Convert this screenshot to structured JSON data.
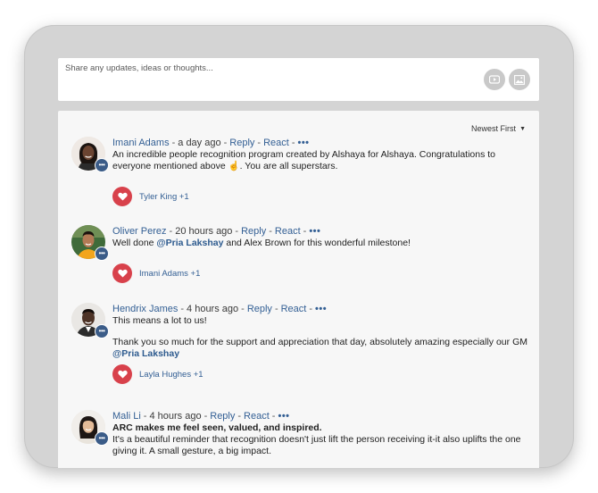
{
  "composer": {
    "placeholder": "Share any updates, ideas or thoughts..."
  },
  "feed": {
    "sort_label": "Newest First",
    "separator": "-",
    "reply_label": "Reply",
    "react_label": "React",
    "more_label": "•••",
    "comments": [
      {
        "author": "Imani Adams",
        "time": "a day ago",
        "body_1": "An incredible people recognition program created by Alshaya for Alshaya. Congratulations to everyone mentioned above ☝. You are all superstars.",
        "reactors": "Tyler King +1"
      },
      {
        "author": "Oliver Perez",
        "time": "20 hours ago",
        "body_1a": "Well done ",
        "mention": "@Pria Lakshay",
        "body_1b": " and Alex Brown for this wonderful milestone!",
        "reactors": "Imani Adams +1"
      },
      {
        "author": "Hendrix James",
        "time": "4 hours ago",
        "body_1": "This means a lot to us!",
        "body_2a": "Thank you so much for the support and appreciation that day, absolutely amazing especially our GM ",
        "mention": "@Pria Lakshay",
        "reactors": "Layla Hughes +1"
      },
      {
        "author": "Mali Li",
        "time": "4 hours ago",
        "body_bold": "ARC makes me feel seen, valued, and inspired.",
        "body_1": "It's a beautiful reminder that recognition doesn't just lift the person receiving it-it also uplifts the one giving it. A small gesture, a big impact."
      }
    ]
  },
  "icons": {
    "video": "video-icon",
    "image": "image-icon",
    "heart": "heart-icon",
    "badge": "more-badge-icon",
    "caret": "caret-down-icon"
  },
  "colors": {
    "link": "#335f94",
    "heart": "#d8414b",
    "badge": "#3b5c88"
  }
}
